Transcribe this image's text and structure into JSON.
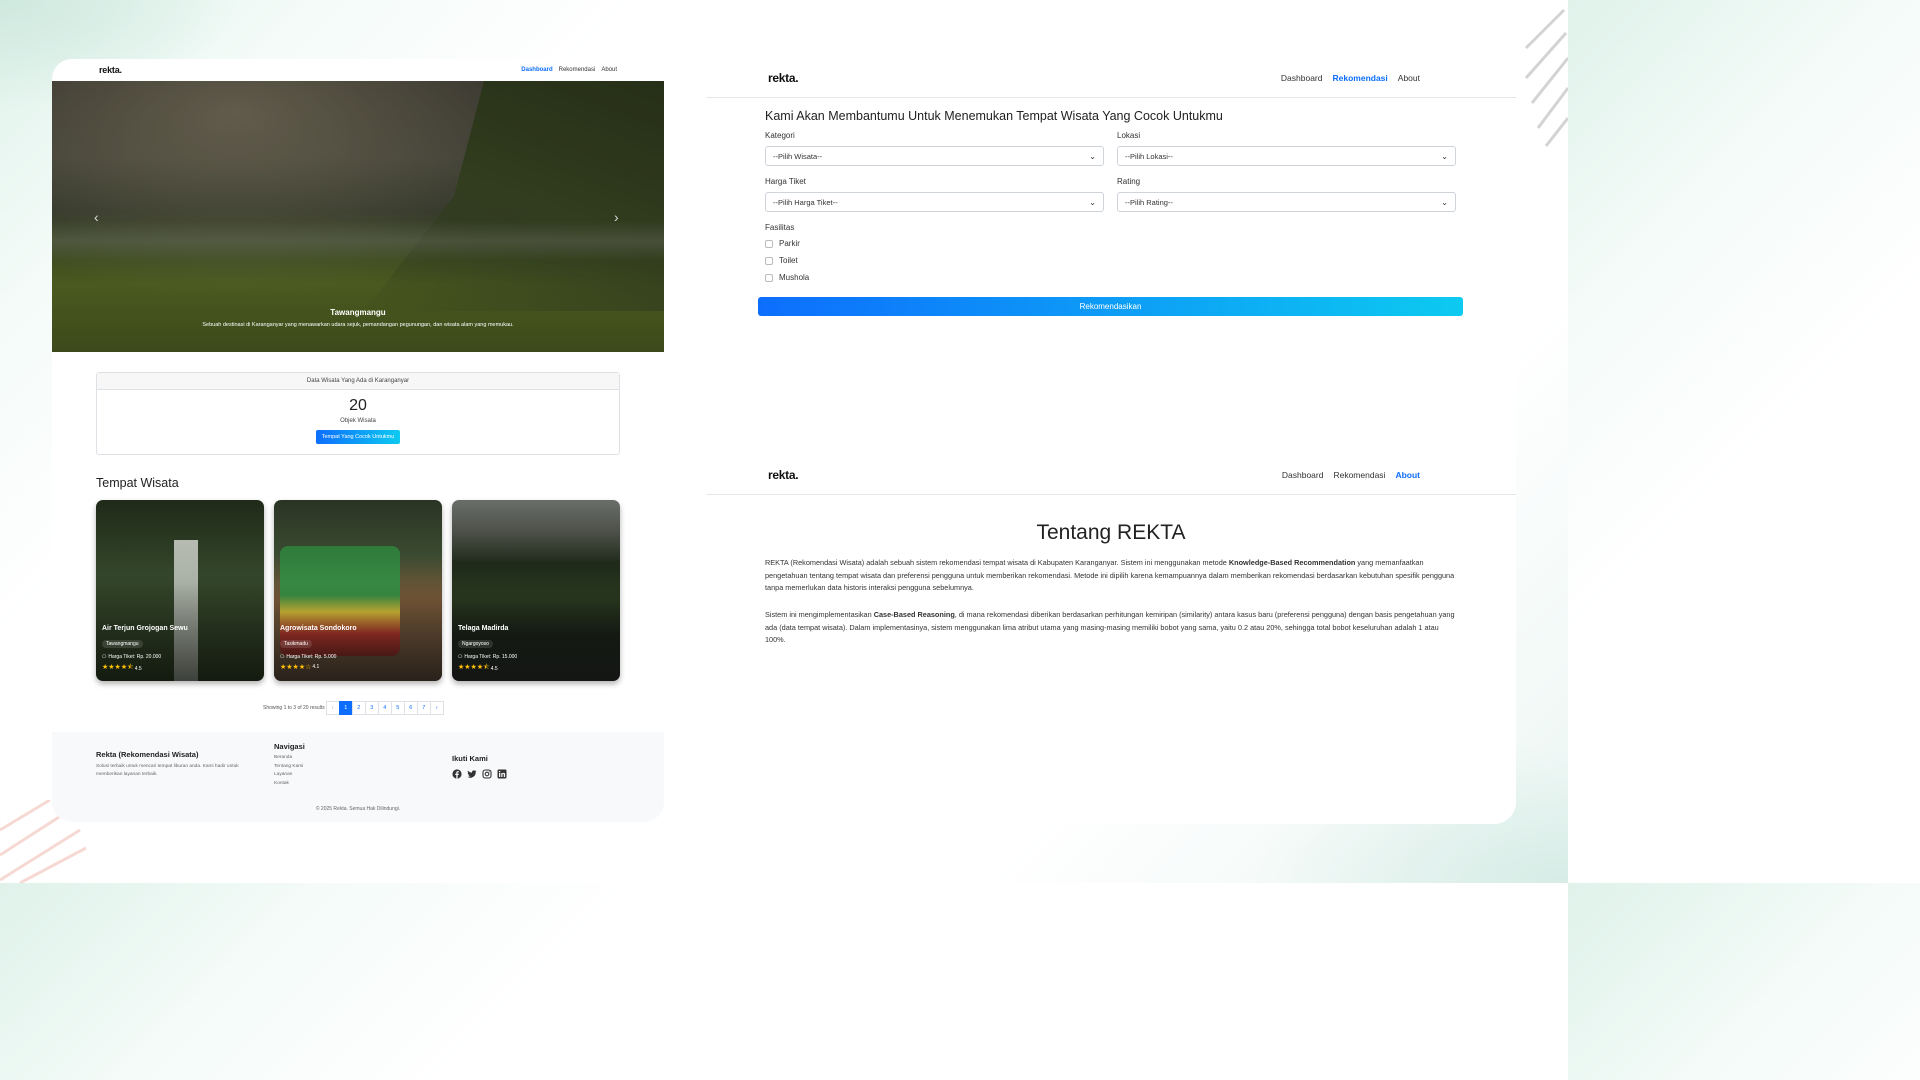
{
  "dashboard": {
    "brand": "rekta.",
    "nav": [
      "Dashboard",
      "Rekomendasi",
      "About"
    ],
    "hero": {
      "title": "Tawangmangu",
      "desc": "Sebuah destinasi di Karanganyar yang menawarkan udara sejuk, pemandangan pegunungan, dan wisata alam yang memukau.",
      "prev": "‹",
      "next": "›"
    },
    "stats": {
      "header": "Data Wisata Yang Ada di Karanganyar",
      "count": "20",
      "label": "Objek Wisata",
      "button": "Tempat Yang Cocok Untukmu"
    },
    "section_title": "Tempat Wisata",
    "cards": [
      {
        "name": "Air Terjun Grojogan Sewu",
        "location": "Tawangmangu",
        "price": "Harga Tiket: Rp. 20.000",
        "stars": "★★★★⯪",
        "rating": "4.5"
      },
      {
        "name": "Agrowisata Sondokoro",
        "location": "Tasikmadu",
        "price": "Harga Tiket: Rp. 5.000",
        "stars": "★★★★☆",
        "rating": "4.1"
      },
      {
        "name": "Telaga Madirda",
        "location": "Ngargoyoso",
        "price": "Harga Tiket: Rp. 15.000",
        "stars": "★★★★⯪",
        "rating": "4.5"
      }
    ],
    "pagination": {
      "info": "Showing 1 to 3 of 20 results",
      "prev": "‹",
      "pages": [
        "1",
        "2",
        "3",
        "4",
        "5",
        "6",
        "7"
      ],
      "next": "›",
      "current": "1"
    },
    "footer": {
      "title": "Rekta (Rekomendasi Wisata)",
      "desc": "Solusi terbaik untuk mencari tempat liburan anda. Kami hadir untuk memberikan layanan terbaik.",
      "nav_title": "Navigasi",
      "nav": [
        "Beranda",
        "Tentang Kami",
        "Layanan",
        "Kontak"
      ],
      "follow_title": "Ikuti Kami",
      "social_icons": [
        "facebook-icon",
        "twitter-icon",
        "instagram-icon",
        "linkedin-icon"
      ],
      "copyright": "© 2025 Rekta. Semua Hak Dilindungi."
    }
  },
  "recommend": {
    "brand": "rekta.",
    "nav": [
      "Dashboard",
      "Rekomendasi",
      "About"
    ],
    "title": "Kami Akan Membantumu Untuk Menemukan Tempat Wisata Yang Cocok Untukmu",
    "kategori_label": "Kategori",
    "kategori_value": "--Pilih Wisata--",
    "lokasi_label": "Lokasi",
    "lokasi_value": "--Pilih Lokasi--",
    "harga_label": "Harga Tiket",
    "harga_value": "--Pilih Harga Tiket--",
    "rating_label": "Rating",
    "rating_value": "--Pilih Rating--",
    "fasilitas_label": "Fasilitas",
    "fasilitas": [
      "Parkir",
      "Toilet",
      "Mushola"
    ],
    "button": "Rekomendasikan"
  },
  "about": {
    "brand": "rekta.",
    "nav": [
      "Dashboard",
      "Rekomendasi",
      "About"
    ],
    "title": "Tentang REKTA",
    "p1_a": "REKTA (Rekomendasi Wisata) adalah sebuah sistem rekomendasi tempat wisata di Kabupaten Karanganyar. Sistem ini menggunakan metode ",
    "p1_b": "Knowledge-Based Recommendation",
    "p1_c": " yang memanfaatkan pengetahuan tentang tempat wisata dan preferensi pengguna untuk memberikan rekomendasi. Metode ini dipilih karena kemampuannya dalam memberikan rekomendasi berdasarkan kebutuhan spesifik pengguna tanpa memerlukan data historis interaksi pengguna sebelumnya.",
    "p2_a": "Sistem ini mengimplementasikan ",
    "p2_b": "Case-Based Reasoning",
    "p2_c": ", di mana rekomendasi diberikan berdasarkan perhitungan kemiripan (similarity) antara kasus baru (preferensi pengguna) dengan basis pengetahuan yang ada (data tempat wisata). Dalam implementasinya, sistem menggunakan lima atribut utama yang masing-masing memiliki bobot yang sama, yaitu 0.2 atau 20%, sehingga total bobot keseluruhan adalah 1 atau 100%."
  },
  "colors": {
    "primary": "#0d6efd",
    "accent": "#0dcaf0",
    "star": "#ffc107"
  }
}
